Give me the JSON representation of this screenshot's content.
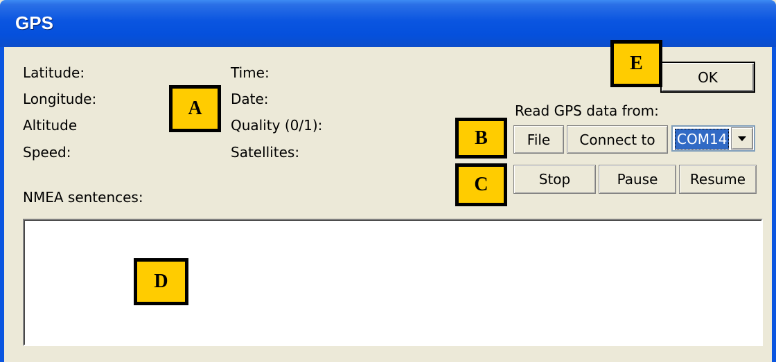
{
  "window": {
    "title": "GPS"
  },
  "gps_fields": {
    "latitude": "Latitude:",
    "longitude": "Longitude:",
    "altitude": "Altitude",
    "speed": "Speed:",
    "time": "Time:",
    "date": "Date:",
    "quality": "Quality (0/1):",
    "satellites": "Satellites:"
  },
  "buttons": {
    "ok": "OK",
    "file": "File",
    "connect": "Connect to",
    "stop": "Stop",
    "pause": "Pause",
    "resume": "Resume"
  },
  "source": {
    "label": "Read GPS data from:",
    "port": "COM14"
  },
  "nmea": {
    "label": "NMEA sentences:",
    "content": ""
  },
  "callouts": {
    "a": "A",
    "b": "B",
    "c": "C",
    "d": "D",
    "e": "E"
  },
  "colors": {
    "titlebar": "#0a55e0",
    "callout_fill": "#ffcc00",
    "selection": "#316ac5",
    "dialog_bg": "#ece9d8"
  }
}
